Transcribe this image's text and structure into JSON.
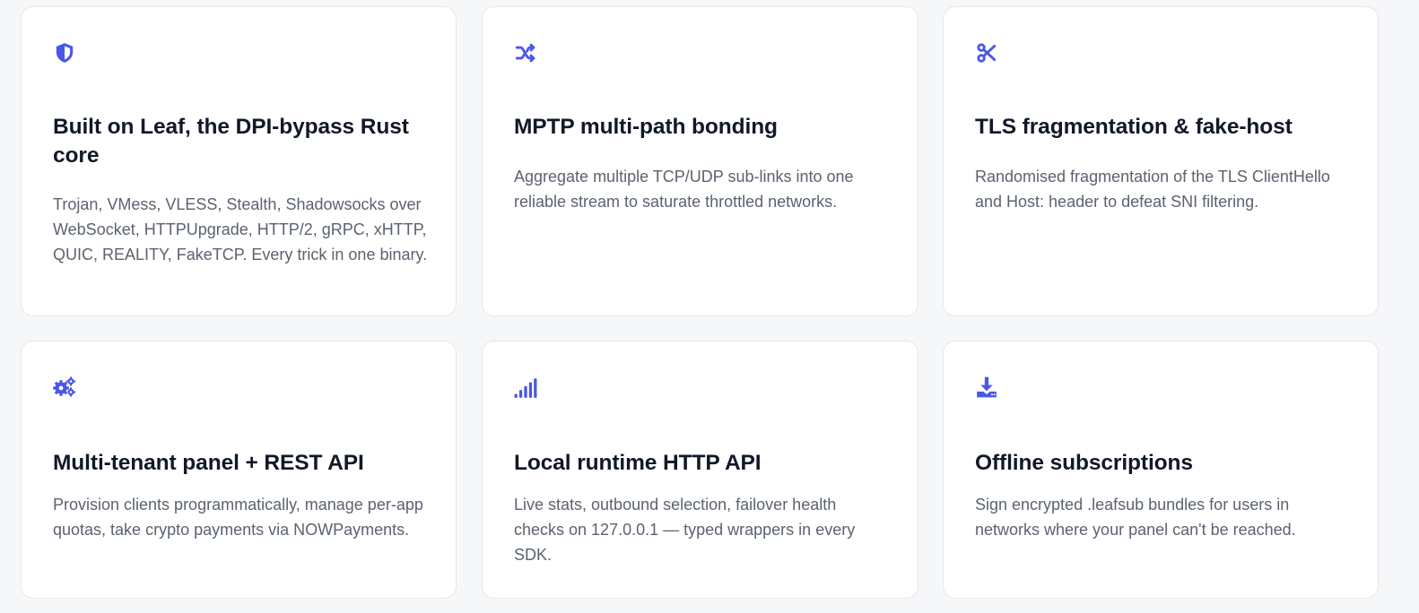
{
  "accent_color": "#4a57e6",
  "features": [
    {
      "icon": "shield-icon",
      "title": "Built on Leaf, the DPI-bypass Rust core",
      "description": "Trojan, VMess, VLESS, Stealth, Shadowsocks over WebSocket, HTTPUpgrade, HTTP/2, gRPC, xHTTP, QUIC, REALITY, FakeTCP. Every trick in one binary."
    },
    {
      "icon": "shuffle-icon",
      "title": "MPTP multi-path bonding",
      "description": "Aggregate multiple TCP/UDP sub-links into one reliable stream to saturate throttled networks."
    },
    {
      "icon": "scissors-icon",
      "title": "TLS fragmentation & fake-host",
      "description": "Randomised fragmentation of the TLS ClientHello and Host: header to defeat SNI filtering."
    },
    {
      "icon": "gears-icon",
      "title": "Multi-tenant panel + REST API",
      "description": "Provision clients programmatically, manage per-app quotas, take crypto payments via NOWPayments."
    },
    {
      "icon": "signal-bars-icon",
      "title": "Local runtime HTTP API",
      "description": "Live stats, outbound selection, failover health checks on 127.0.0.1 — typed wrappers in every SDK."
    },
    {
      "icon": "download-icon",
      "title": "Offline subscriptions",
      "description": "Sign encrypted .leafsub bundles for users in networks where your panel can't be reached."
    }
  ]
}
